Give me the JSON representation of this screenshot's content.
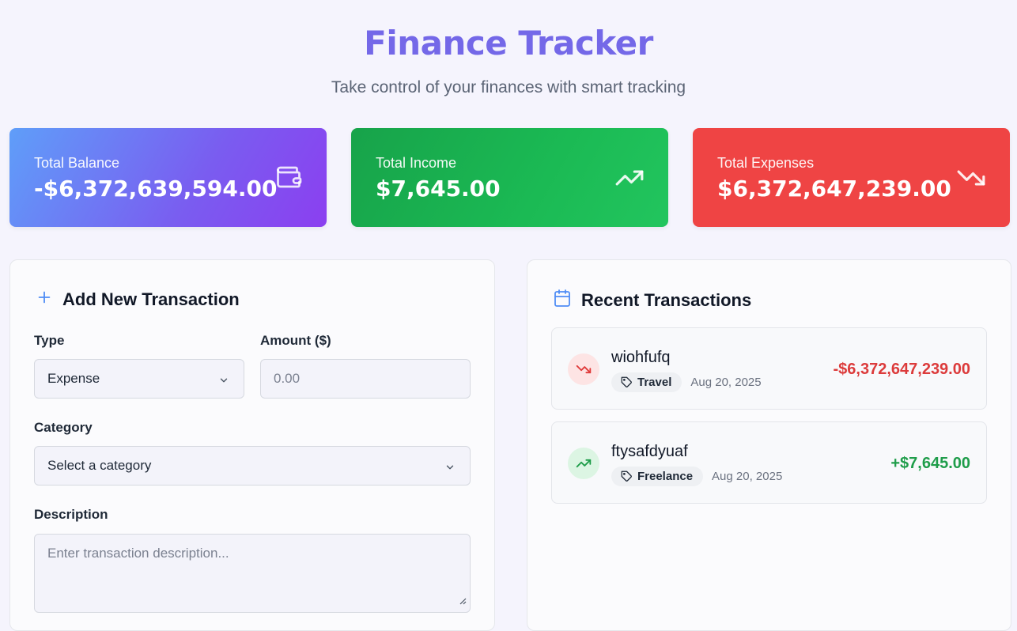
{
  "header": {
    "title": "Finance Tracker",
    "subtitle": "Take control of your finances with smart tracking"
  },
  "summary": {
    "balance": {
      "label": "Total Balance",
      "value": "-$6,372,639,594.00",
      "icon": "wallet-icon"
    },
    "income": {
      "label": "Total Income",
      "value": "$7,645.00",
      "icon": "trending-up-icon"
    },
    "expenses": {
      "label": "Total Expenses",
      "value": "$6,372,647,239.00",
      "icon": "trending-down-icon"
    }
  },
  "form": {
    "title": "Add New Transaction",
    "type_label": "Type",
    "type_value": "Expense",
    "amount_label": "Amount ($)",
    "amount_placeholder": "0.00",
    "category_label": "Category",
    "category_value": "Select a category",
    "description_label": "Description",
    "description_placeholder": "Enter transaction description..."
  },
  "recent": {
    "title": "Recent Transactions",
    "items": [
      {
        "name": "wiohfufq",
        "tag": "Travel",
        "date": "Aug 20, 2025",
        "amount": "-$6,372,647,239.00",
        "kind": "expense"
      },
      {
        "name": "ftysafdyuaf",
        "tag": "Freelance",
        "date": "Aug 20, 2025",
        "amount": "+$7,645.00",
        "kind": "income"
      }
    ]
  },
  "colors": {
    "accent": "#7468e8",
    "income": "#22c55e",
    "expense": "#ef4444",
    "balance_start": "#5f9ef9",
    "balance_end": "#8b3ff0"
  }
}
